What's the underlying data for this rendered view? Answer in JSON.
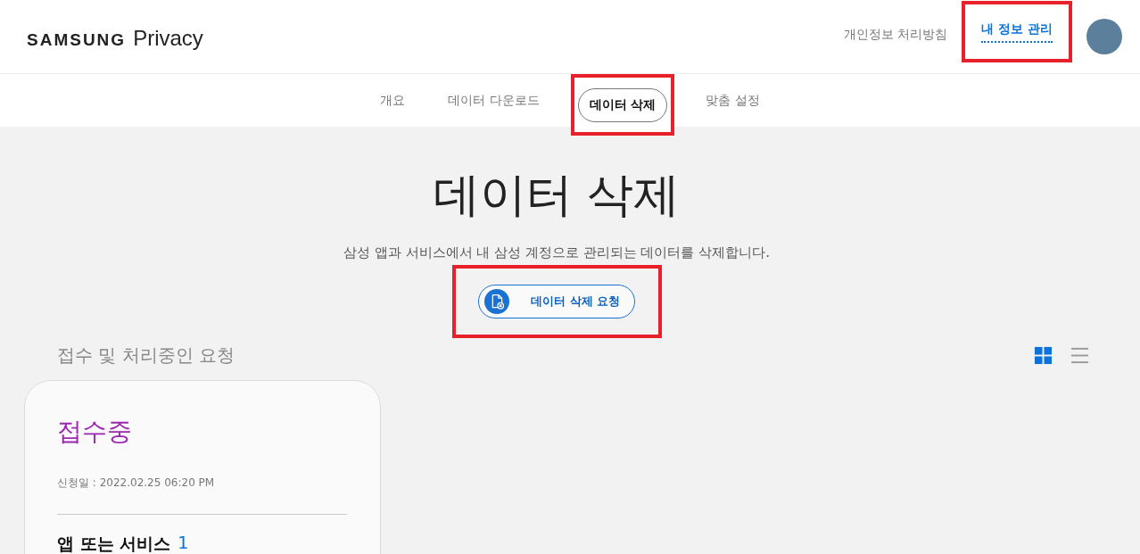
{
  "header": {
    "logo": {
      "brand": "SAMSUNG",
      "product": "Privacy"
    },
    "links": [
      {
        "label": "개인정보 처리방침",
        "selected": false,
        "highlighted": false
      },
      {
        "label": "내 정보 관리",
        "selected": true,
        "highlighted": true
      }
    ]
  },
  "tabs": [
    {
      "label": "개요",
      "selected": false,
      "highlighted": false
    },
    {
      "label": "데이터 다운로드",
      "selected": false,
      "highlighted": false
    },
    {
      "label": "데이터 삭제",
      "selected": true,
      "highlighted": true
    },
    {
      "label": "맞춤 설정",
      "selected": false,
      "highlighted": false
    }
  ],
  "page": {
    "title": "데이터 삭제",
    "description": "삼성 앱과 서비스에서 내 삼성 계정으로 관리되는 데이터를 삭제합니다.",
    "action_button": {
      "label": "데이터 삭제 요청",
      "highlighted": true
    }
  },
  "requests": {
    "heading": "접수 및 처리중인 요청",
    "view_modes": [
      {
        "kind": "grid",
        "selected": true
      },
      {
        "kind": "list",
        "selected": false
      }
    ],
    "cards": [
      {
        "status": "접수중",
        "color": "#9c27b0",
        "date": "신청일 : 2022.02.25 06:20 PM",
        "section_label": "앱 또는 서비스",
        "section_count": "1"
      }
    ]
  }
}
